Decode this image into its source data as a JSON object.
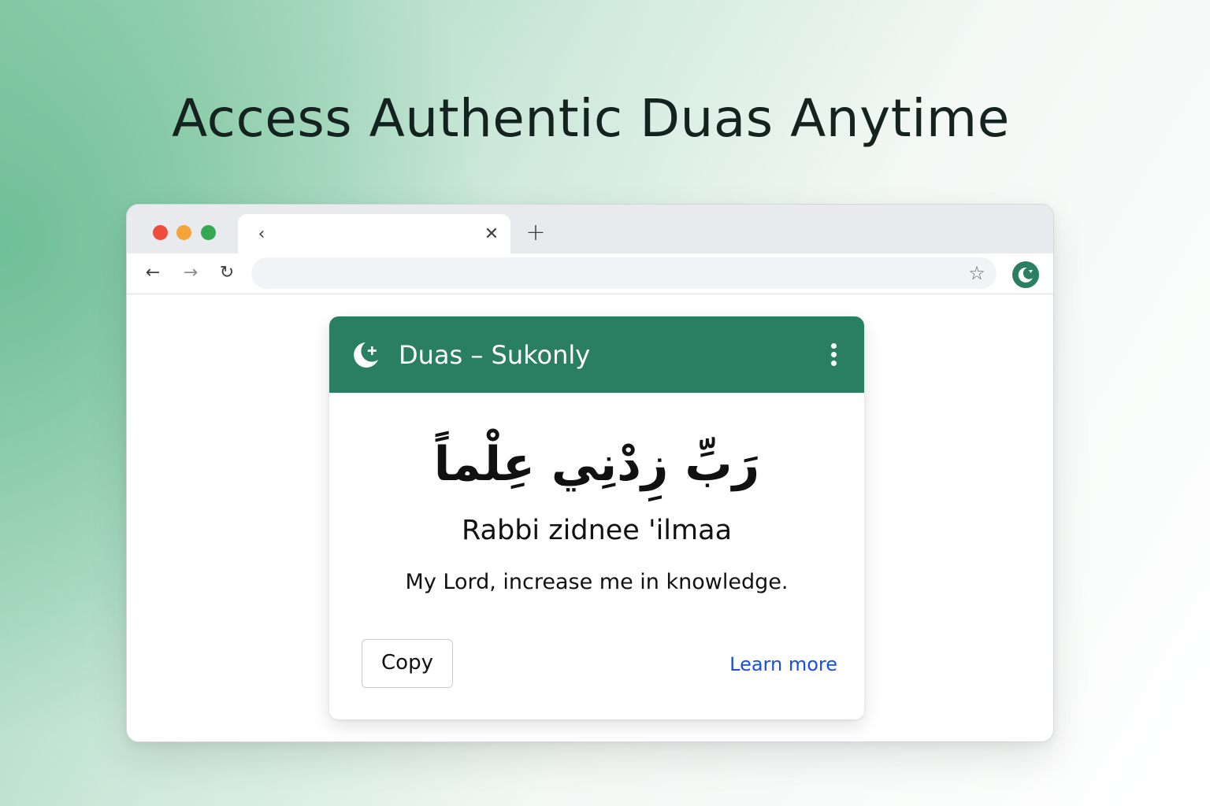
{
  "headline": "Access Authentic Duas Anytime",
  "browser": {
    "tab": {
      "back_glyph": "‹",
      "close_glyph": "✕"
    },
    "new_tab_glyph": "+",
    "toolbar": {
      "back_glyph": "←",
      "forward_glyph": "→",
      "reload_glyph": "↻",
      "star_glyph": "☆",
      "omnibox_value": ""
    },
    "extension_icon": "crescent-moon-icon"
  },
  "popup": {
    "title": "Duas – Sukonly",
    "logo_icon": "crescent-star-icon",
    "menu_icon": "kebab-menu-icon",
    "arabic": "رَبِّ زِدْنِي عِلْماً",
    "transliteration": "Rabbi zidnee 'ilmaa",
    "translation": "My Lord, increase me in knowledge.",
    "copy_label": "Copy",
    "learn_more_label": "Learn more"
  },
  "colors": {
    "brand_green": "#2a7f62",
    "link_blue": "#1a4fd6",
    "traffic_red": "#f04c3e",
    "traffic_yellow": "#f5a33b",
    "traffic_green": "#34a853"
  }
}
